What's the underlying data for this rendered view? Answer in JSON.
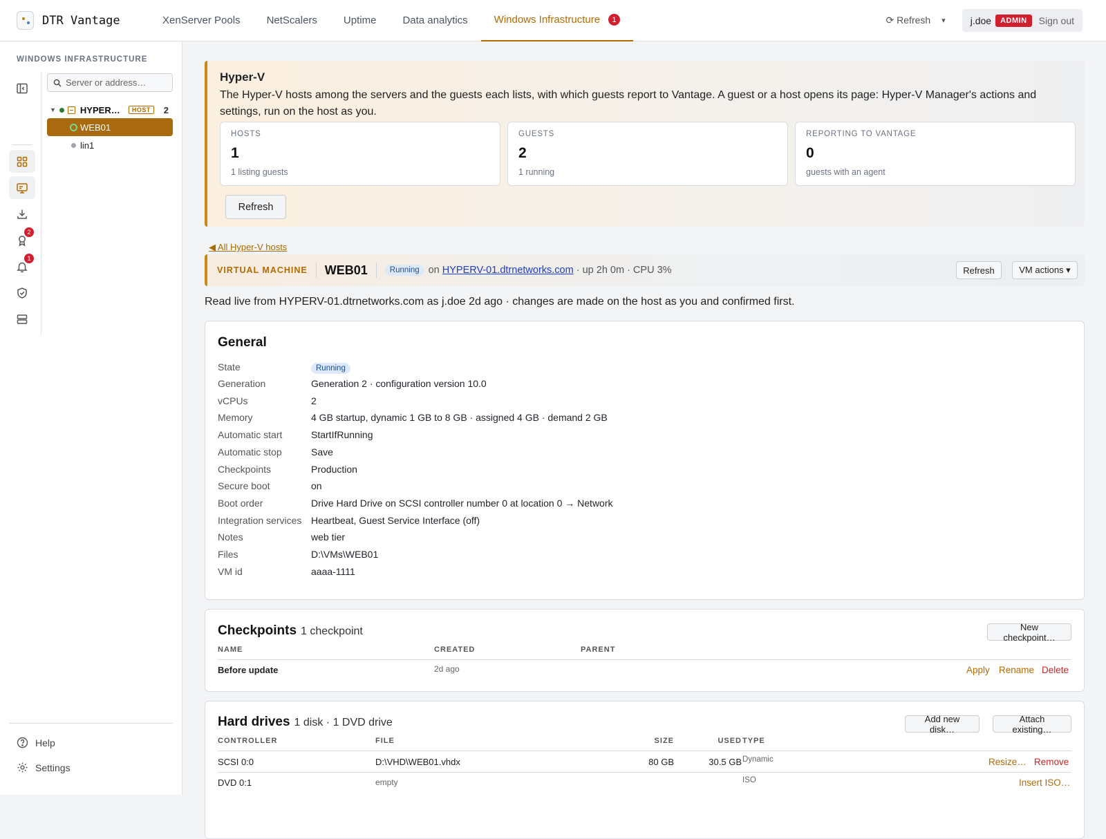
{
  "app": {
    "name": "DTR Vantage"
  },
  "topnav": {
    "tabs": [
      "XenServer Pools",
      "NetScalers",
      "Uptime",
      "Data analytics",
      "Windows Infrastructure"
    ],
    "active_badge": "1",
    "refresh_label": "⟳ Refresh",
    "caret": "▾",
    "user": "j.doe",
    "role": "ADMIN",
    "signout": "Sign out"
  },
  "sidebar": {
    "title": "WINDOWS INFRASTRUCTURE",
    "rail_badges": {
      "awards": "2",
      "alerts": "1"
    },
    "search_placeholder": "Server or address…",
    "host": {
      "name": "HYPER…",
      "tag": "HOST",
      "count": "2",
      "arrow": "▼"
    },
    "vms": [
      "WEB01",
      "lin1"
    ],
    "help": "Help",
    "settings": "Settings"
  },
  "banner": {
    "title": "Hyper-V",
    "description": "The Hyper-V hosts among the servers and the guests each lists, with which guests report to Vantage. A guest or a host opens its page: Hyper-V Manager's actions and settings, run on the host as you.",
    "stats": [
      {
        "label": "HOSTS",
        "value": "1",
        "sub": "1 listing guests"
      },
      {
        "label": "GUESTS",
        "value": "2",
        "sub": "1 running"
      },
      {
        "label": "REPORTING TO VANTAGE",
        "value": "0",
        "sub": "guests with an agent"
      }
    ],
    "refresh": "Refresh"
  },
  "back_link": "◀ All Hyper-V hosts",
  "vm": {
    "kind": "VIRTUAL MACHINE",
    "name": "WEB01",
    "state": "Running",
    "on": "on",
    "host": "HYPERV-01.dtrnetworks.com",
    "meta": "· up 2h 0m · CPU 3%",
    "refresh": "Refresh",
    "actions": "VM actions ▾",
    "read_live": "Read live from HYPERV-01.dtrnetworks.com as j.doe 2d ago · changes are made on the host as you and confirmed first."
  },
  "general": {
    "title": "General",
    "state_key": "State",
    "state_value": "Running",
    "rows": [
      {
        "k": "Generation",
        "v": "Generation 2 · configuration version 10.0"
      },
      {
        "k": "vCPUs",
        "v": "2"
      },
      {
        "k": "Memory",
        "v": "4 GB startup, dynamic 1 GB to 8 GB · assigned 4 GB · demand 2 GB"
      },
      {
        "k": "Automatic start",
        "v": "StartIfRunning"
      },
      {
        "k": "Automatic stop",
        "v": "Save"
      },
      {
        "k": "Checkpoints",
        "v": "Production"
      },
      {
        "k": "Secure boot",
        "v": "on"
      },
      {
        "k": "Boot order",
        "v": "Drive Hard Drive on SCSI controller number 0 at location 0 → Network"
      },
      {
        "k": "Integration services",
        "v": "Heartbeat, Guest Service Interface (off)"
      },
      {
        "k": "Notes",
        "v": "web tier"
      },
      {
        "k": "Files",
        "v": "D:\\VMs\\WEB01"
      },
      {
        "k": "VM id",
        "v": "aaaa-1111"
      }
    ]
  },
  "checkpoints": {
    "title": "Checkpoints",
    "subtitle": "1 checkpoint",
    "new_button": "New checkpoint…",
    "columns": [
      "NAME",
      "CREATED",
      "PARENT"
    ],
    "rows": [
      {
        "name": "Before update",
        "created": "2d ago",
        "parent": ""
      }
    ],
    "actions": [
      "Apply",
      "Rename",
      "Delete"
    ]
  },
  "hard_drives": {
    "title": "Hard drives",
    "subtitle": "1 disk · 1 DVD drive",
    "add_button": "Add new disk…",
    "attach_button": "Attach existing…",
    "columns": [
      "CONTROLLER",
      "FILE",
      "SIZE",
      "USED",
      "TYPE"
    ],
    "rows": [
      {
        "controller": "SCSI 0:0",
        "file": "D:\\VHD\\WEB01.vhdx",
        "size": "80 GB",
        "used": "30.5 GB",
        "type": "Dynamic",
        "action1": "Resize…",
        "action2": "Remove"
      },
      {
        "controller": "DVD 0:1",
        "file": "empty",
        "size": "",
        "used": "",
        "type": "ISO",
        "action1": "Insert ISO…"
      }
    ]
  }
}
